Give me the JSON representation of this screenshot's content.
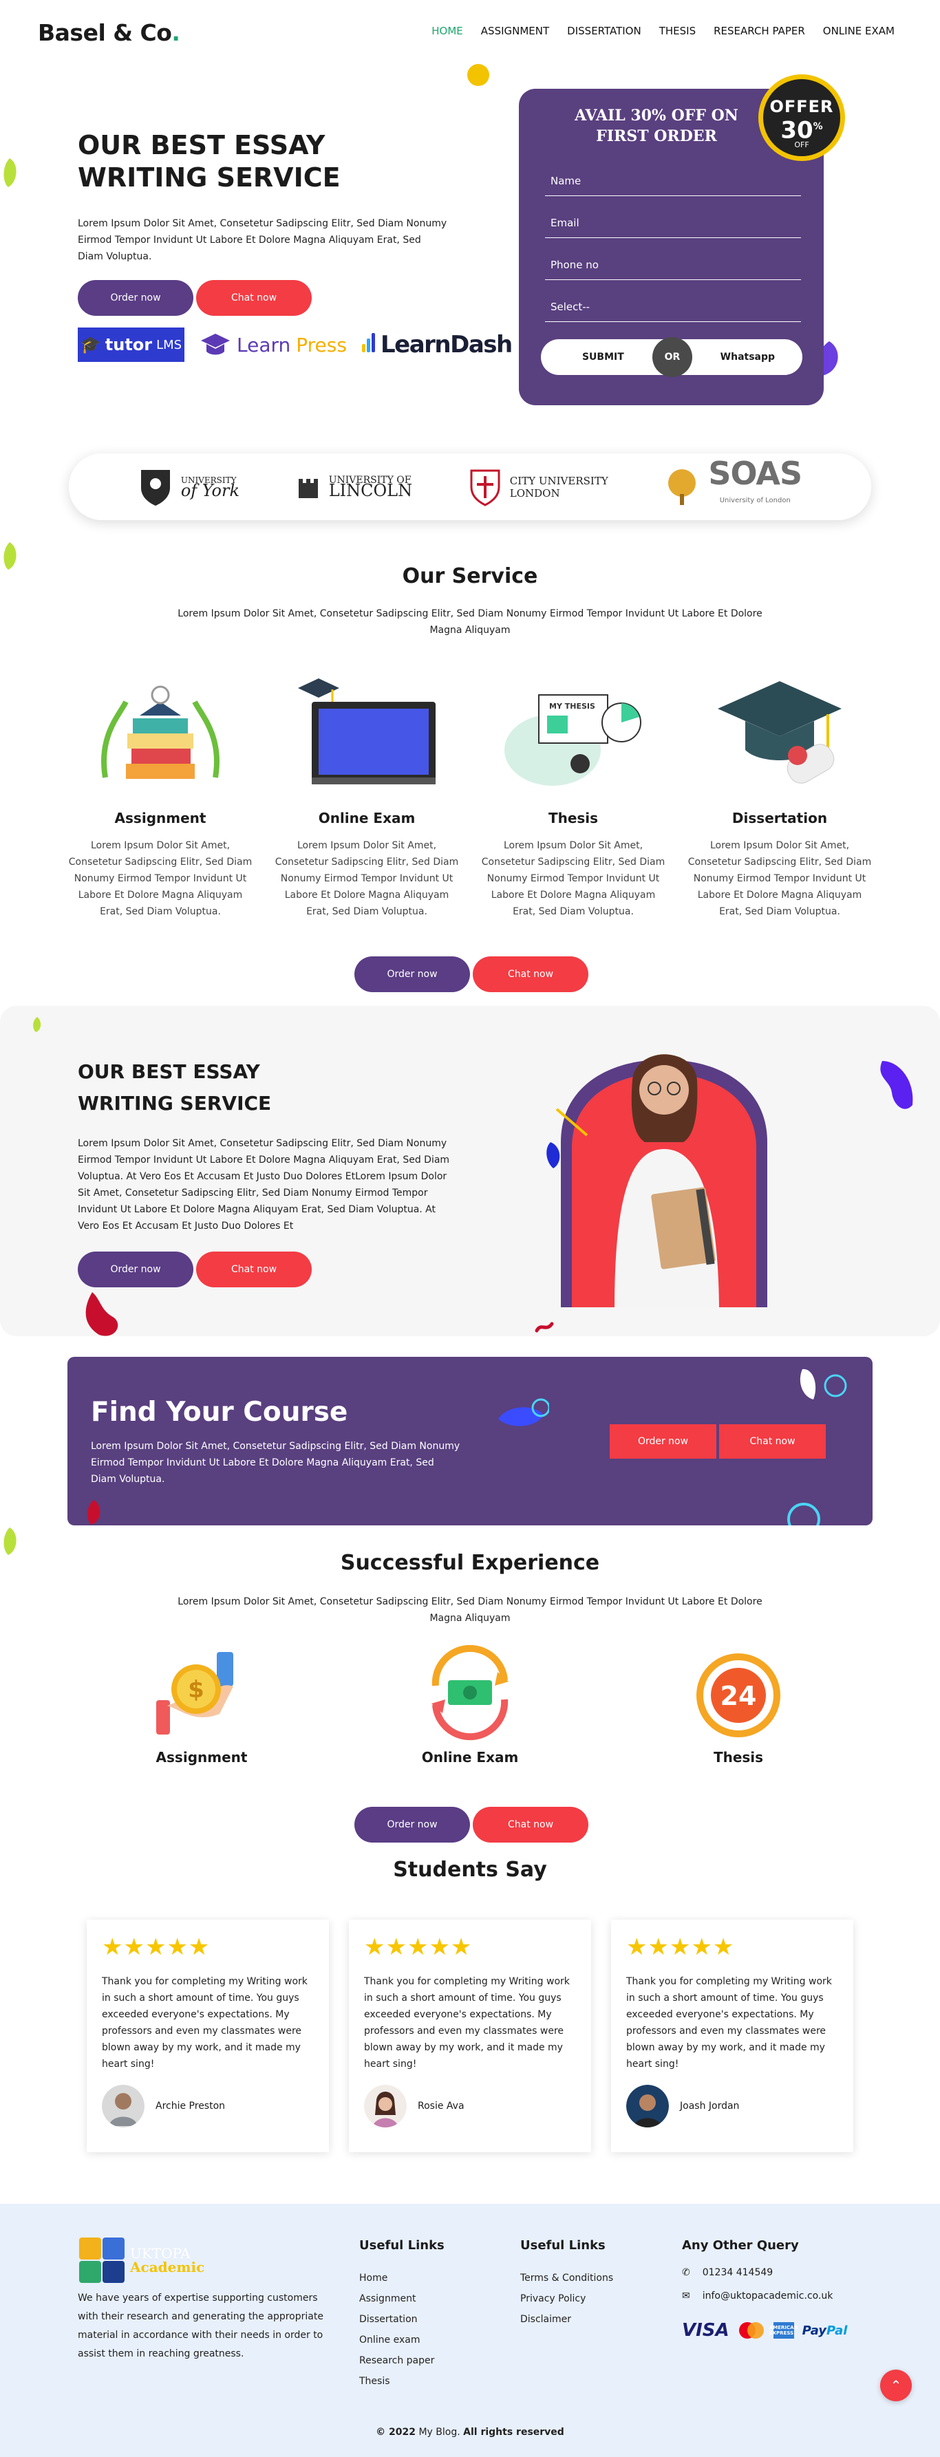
{
  "header": {
    "logo": "Basel & Co",
    "logo_dot": ".",
    "nav": [
      "HOME",
      "ASSIGNMENT",
      "DISSERTATION",
      "THESIS",
      "RESEARCH PAPER",
      "ONLINE EXAM"
    ]
  },
  "hero": {
    "title": "OUR BEST ESSAY WRITING SERVICE",
    "text": "Lorem Ipsum Dolor Sit Amet, Consetetur Sadipscing Elitr, Sed Diam Nonumy Eirmod Tempor Invidunt Ut Labore Et Dolore Magna Aliquyam Erat, Sed Diam Voluptua.",
    "order_label": "Order now",
    "chat_label": "Chat now",
    "partners": {
      "tutor": "tutor",
      "tutor_suffix": "LMS",
      "learnpress_1": "Learn",
      "learnpress_2": "Press",
      "learndash": "LearnDash"
    }
  },
  "form": {
    "title": "AVAIL 30% OFF ON FIRST ORDER",
    "name_placeholder": "Name",
    "email_placeholder": "Email",
    "phone_placeholder": "Phone no",
    "select_value": "Select--",
    "submit_label": "SUBMIT",
    "or_label": "OR",
    "whatsapp_label": "Whatsapp",
    "badge_offer": "OFFER",
    "badge_percent": "30",
    "badge_sup": "%",
    "badge_off": "OFF"
  },
  "universities": {
    "york_1": "UNIVERSITY",
    "york_2": "of York",
    "lincoln_1": "UNIVERSITY OF",
    "lincoln_2": "LINCOLN",
    "city_1": "CITY UNIVERSITY",
    "city_2": "LONDON",
    "soas_1": "SOAS",
    "soas_2": "University of London"
  },
  "services": {
    "title": "Our Service",
    "subtitle": "Lorem Ipsum Dolor Sit Amet, Consetetur Sadipscing Elitr, Sed Diam Nonumy Eirmod Tempor Invidunt Ut Labore Et Dolore Magna Aliquyam",
    "items": [
      {
        "title": "Assignment",
        "text": "Lorem Ipsum Dolor Sit Amet, Consetetur Sadipscing Elitr, Sed Diam Nonumy Eirmod Tempor Invidunt Ut Labore Et Dolore Magna Aliquyam Erat, Sed Diam Voluptua."
      },
      {
        "title": "Online Exam",
        "text": "Lorem Ipsum Dolor Sit Amet, Consetetur Sadipscing Elitr, Sed Diam Nonumy Eirmod Tempor Invidunt Ut Labore Et Dolore Magna Aliquyam Erat, Sed Diam Voluptua."
      },
      {
        "title": "Thesis",
        "text": "Lorem Ipsum Dolor Sit Amet, Consetetur Sadipscing Elitr, Sed Diam Nonumy Eirmod Tempor Invidunt Ut Labore Et Dolore Magna Aliquyam Erat, Sed Diam Voluptua."
      },
      {
        "title": "Dissertation",
        "text": "Lorem Ipsum Dolor Sit Amet, Consetetur Sadipscing Elitr, Sed Diam Nonumy Eirmod Tempor Invidunt Ut Labore Et Dolore Magna Aliquyam Erat, Sed Diam Voluptua."
      }
    ],
    "thesis_board": "MY THESIS",
    "order_label": "Order now",
    "chat_label": "Chat now"
  },
  "essay": {
    "title": "OUR BEST ESSAY WRITING SERVICE",
    "text": "Lorem Ipsum Dolor Sit Amet, Consetetur Sadipscing Elitr, Sed Diam Nonumy Eirmod Tempor Invidunt Ut Labore Et Dolore Magna Aliquyam Erat, Sed Diam Voluptua. At Vero Eos Et Accusam Et Justo Duo Dolores EtLorem Ipsum Dolor Sit Amet, Consetetur Sadipscing Elitr, Sed Diam Nonumy Eirmod Tempor Invidunt Ut Labore Et Dolore Magna Aliquyam Erat, Sed Diam Voluptua. At Vero Eos Et Accusam Et Justo Duo Dolores Et",
    "order_label": "Order now",
    "chat_label": "Chat now"
  },
  "course": {
    "title": "Find Your Course",
    "text": "Lorem Ipsum Dolor Sit Amet, Consetetur Sadipscing Elitr, Sed Diam Nonumy Eirmod Tempor Invidunt Ut Labore Et Dolore Magna Aliquyam Erat, Sed Diam Voluptua.",
    "order_label": "Order now",
    "chat_label": "Chat now"
  },
  "experience": {
    "title": "Successful Experience",
    "subtitle": "Lorem Ipsum Dolor Sit Amet, Consetetur Sadipscing Elitr, Sed Diam Nonumy Eirmod Tempor Invidunt Ut Labore Et Dolore Magna Aliquyam",
    "items": [
      {
        "title": "Assignment",
        "icon": "dollar-hand-icon",
        "glyph": "$"
      },
      {
        "title": "Online Exam",
        "icon": "money-cycle-icon",
        "glyph": ""
      },
      {
        "title": "Thesis",
        "icon": "24-hours-icon",
        "glyph": "24"
      }
    ],
    "order_label": "Order now",
    "chat_label": "Chat now"
  },
  "testimonials": {
    "title": "Students Say",
    "stars": "★★★★★",
    "items": [
      {
        "text": "Thank you for completing my Writing work in such a short amount of time. You guys exceeded everyone's expectations. My professors and even my classmates were blown away by my work, and it made my heart sing!",
        "author": "Archie Preston"
      },
      {
        "text": "Thank you for completing my Writing work in such a short amount of time. You guys exceeded everyone's expectations. My professors and even my classmates were blown away by my work, and it made my heart sing!",
        "author": "Rosie Ava"
      },
      {
        "text": "Thank you for completing my Writing work in such a short amount of time. You guys exceeded everyone's expectations. My professors and even my classmates were blown away by my work, and it made my heart sing!",
        "author": "Joash Jordan"
      }
    ]
  },
  "footer": {
    "logo_1": "UKTOPA",
    "logo_2": "Academic",
    "about": "We have years of expertise supporting customers with their research and generating the appropriate material in accordance with their needs in order to assist them in reaching greatness.",
    "col1_title": "Useful Links",
    "col1_links": [
      "Home",
      "Assignment",
      "Dissertation",
      "Online exam",
      "Research paper",
      "Thesis"
    ],
    "col2_title": "Useful Links",
    "col2_links": [
      "Terms & Conditions",
      "Privacy Policy",
      "Disclaimer"
    ],
    "col3_title": "Any Other Query",
    "phone": "01234 414549",
    "email": "info@uktopacademic.co.uk",
    "pay_visa": "VISA",
    "pay_amex": "AMERICAN EXPRESS",
    "pay_paypal_1": "Pay",
    "pay_paypal_2": "Pal",
    "copyright_1": "© 2022",
    "copyright_2": "My Blog.",
    "copyright_3": "All rights reserved"
  },
  "colors": {
    "primary_purple": "#59407f",
    "accent_red": "#f33c44",
    "nav_active": "#1ea66d",
    "star_yellow": "#f7c600",
    "footer_bg": "#e8f0fb"
  }
}
